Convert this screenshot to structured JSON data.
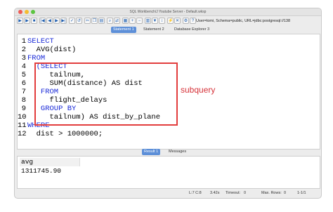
{
  "window": {
    "title": "SQL Workbench/J Youtube Server - Default.wksp"
  },
  "toolbar": {
    "connection_info": "User=tomi, Schema=public, URL=jdbc:postgresql://138"
  },
  "tabs": [
    {
      "label": "Statement 1"
    },
    {
      "label": "Statement 2"
    },
    {
      "label": "Database Explorer 3"
    }
  ],
  "editor": {
    "lines": [
      {
        "no": "1",
        "text": "SELECT"
      },
      {
        "no": "2",
        "text": "  AVG(dist)"
      },
      {
        "no": "3",
        "text": "FROM"
      },
      {
        "no": "4",
        "text": "  (SELECT"
      },
      {
        "no": "5",
        "text": "     tailnum,"
      },
      {
        "no": "6",
        "text": "     SUM(distance) AS dist"
      },
      {
        "no": "7",
        "text": "   FROM"
      },
      {
        "no": "8",
        "text": "     flight_delays"
      },
      {
        "no": "9",
        "text": "   GROUP BY"
      },
      {
        "no": "10",
        "text": "     tailnum) AS dist_by_plane"
      },
      {
        "no": "11",
        "text": "WHERE"
      },
      {
        "no": "12",
        "text": "  dist > 1000000;"
      }
    ],
    "annotation": "subquery"
  },
  "result_tabs": [
    {
      "label": "Result 1"
    },
    {
      "label": "Messages"
    }
  ],
  "result": {
    "columns": [
      "avg"
    ],
    "rows": [
      [
        "1311745.90"
      ]
    ]
  },
  "status": {
    "position": "L:7 C:8",
    "time": "3.42s",
    "timeout_label": "Timeout:",
    "timeout_value": "0",
    "maxrows_label": "Max. Rows:",
    "maxrows_value": "0",
    "range": "1-1/1"
  },
  "colors": {
    "accent": "#5d8fd8",
    "keyword": "#1a2ad8",
    "highlight": "#e23d3d"
  }
}
